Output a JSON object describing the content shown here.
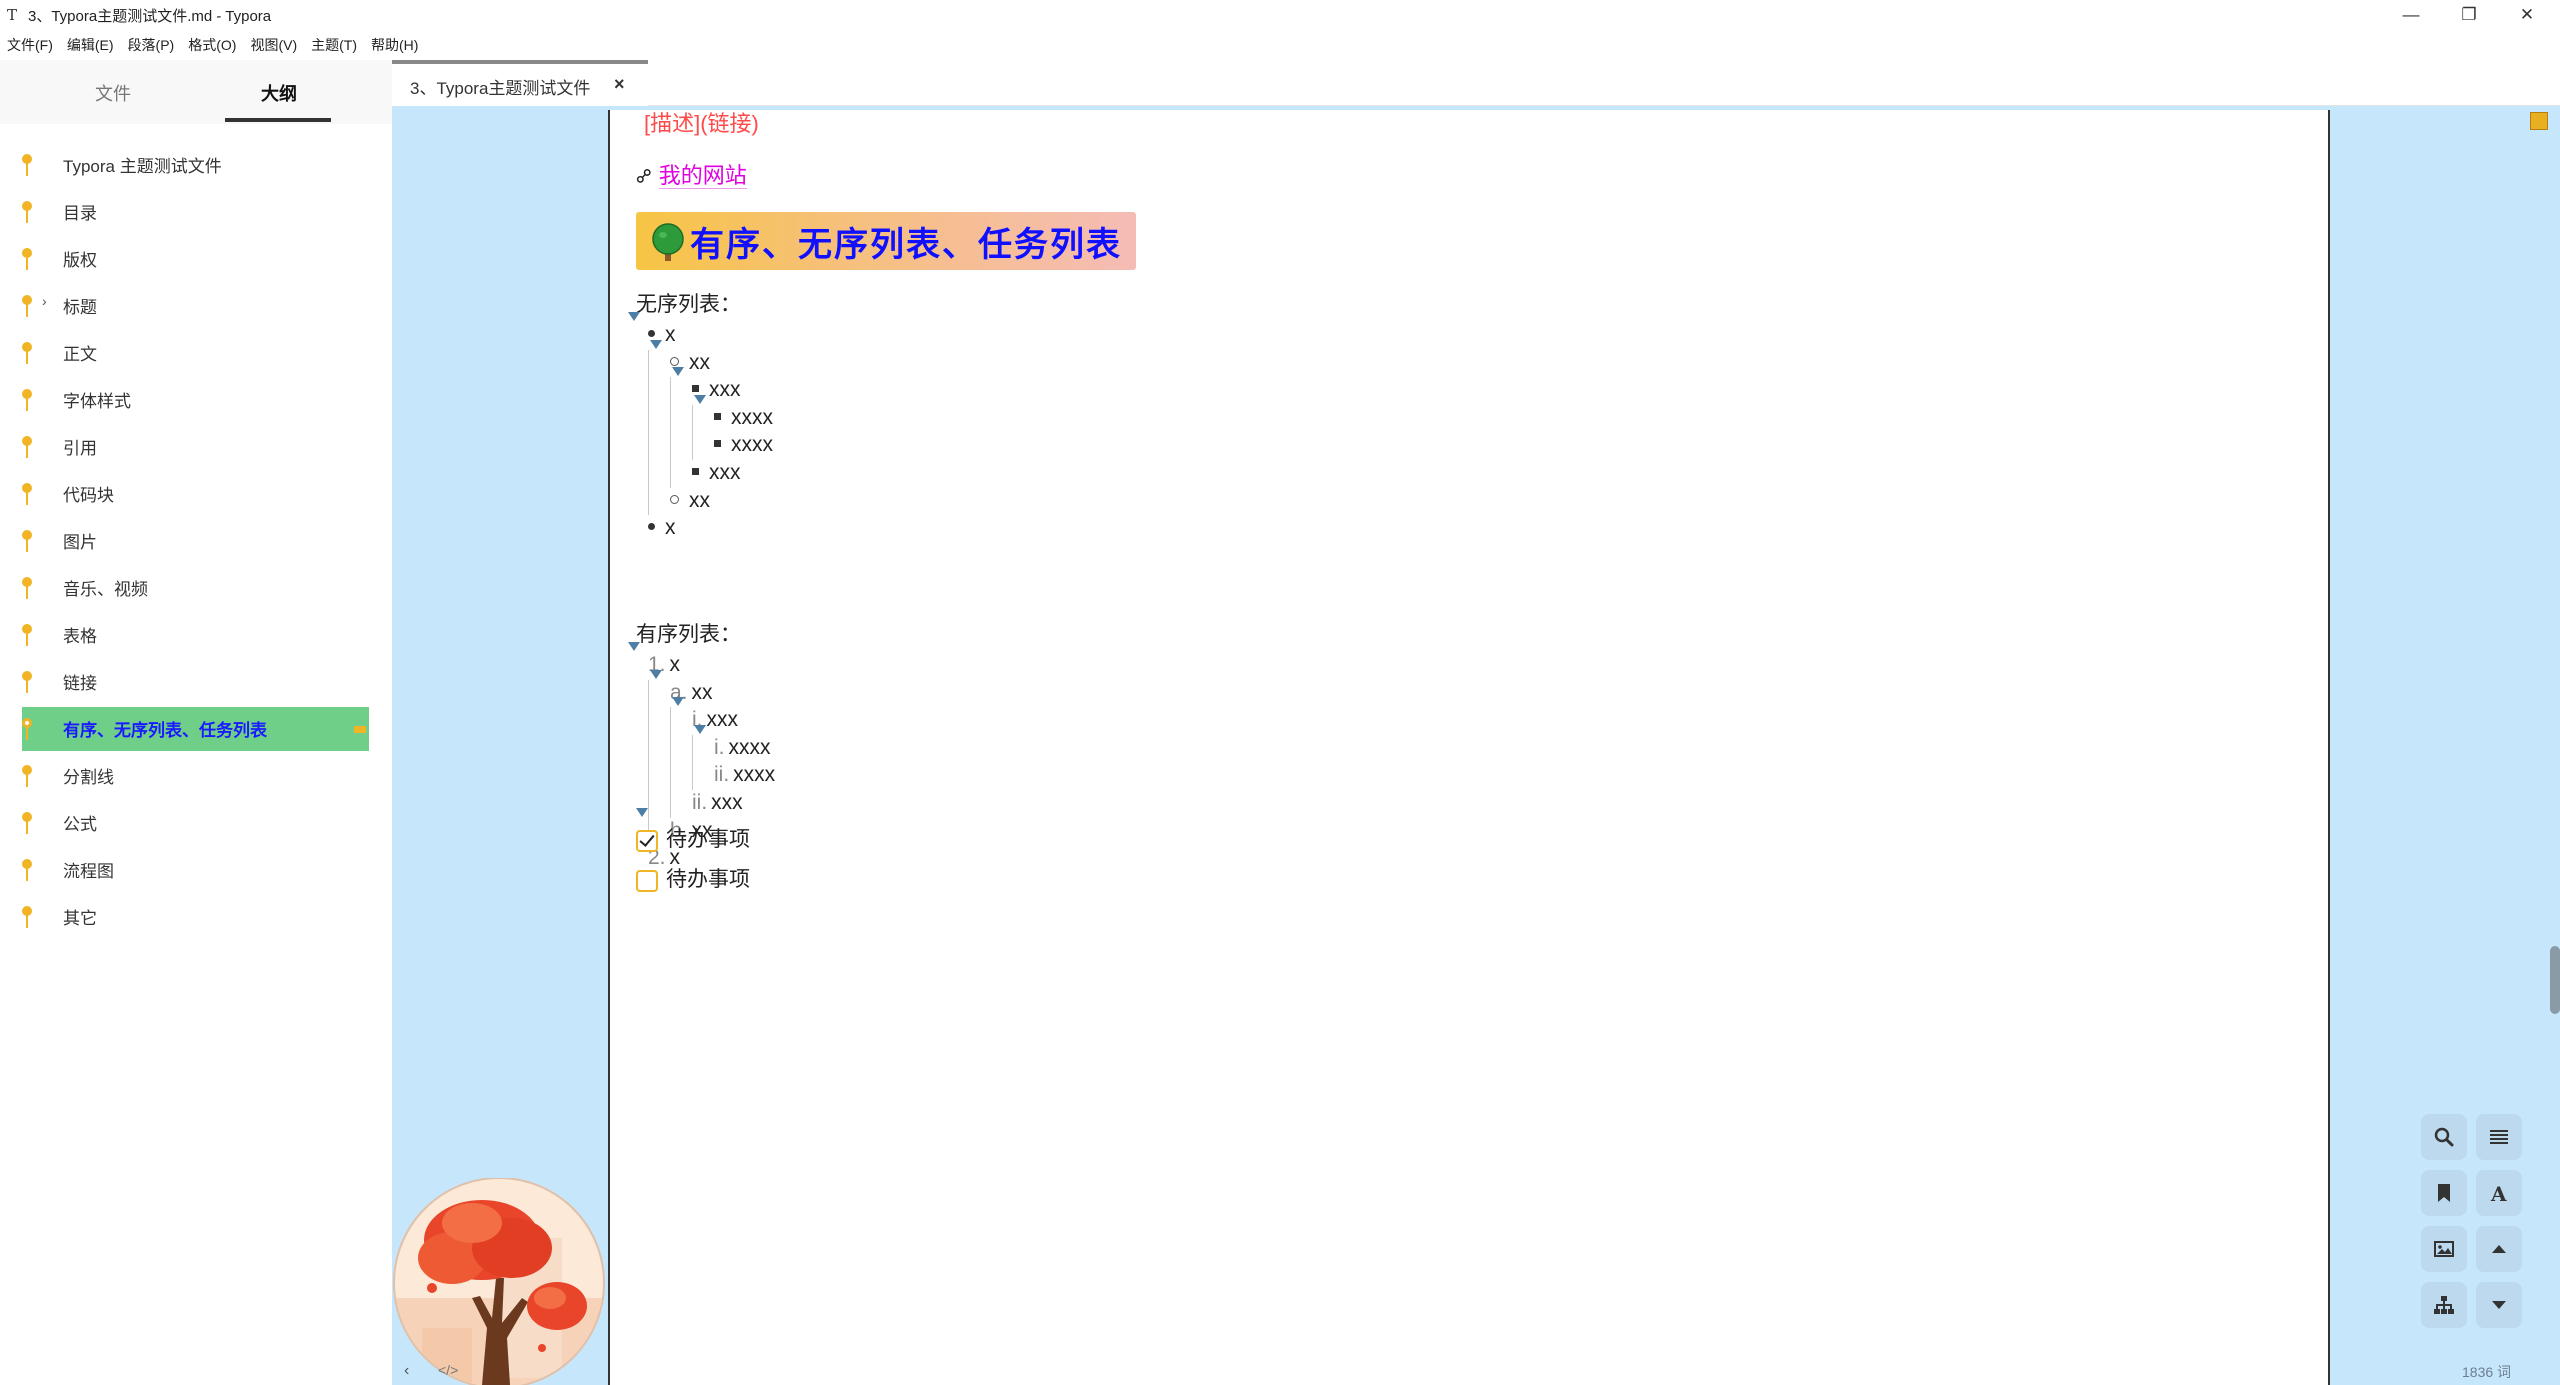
{
  "window": {
    "app_icon": "T",
    "title": "3、Typora主题测试文件.md - Typora",
    "min": "—",
    "max": "❐",
    "close": "✕"
  },
  "menu": [
    "文件(F)",
    "编辑(E)",
    "段落(P)",
    "格式(O)",
    "视图(V)",
    "主题(T)",
    "帮助(H)"
  ],
  "sidebar": {
    "tab_files": "文件",
    "tab_outline": "大纲",
    "outline": [
      {
        "label": "Typora 主题测试文件"
      },
      {
        "label": "目录"
      },
      {
        "label": "版权"
      },
      {
        "label": "标题",
        "caret": "›"
      },
      {
        "label": "正文"
      },
      {
        "label": "字体样式"
      },
      {
        "label": "引用"
      },
      {
        "label": "代码块"
      },
      {
        "label": "图片"
      },
      {
        "label": "音乐、视频"
      },
      {
        "label": "表格"
      },
      {
        "label": "链接"
      },
      {
        "label": "有序、无序列表、任务列表",
        "active": true
      },
      {
        "label": "分割线"
      },
      {
        "label": "公式"
      },
      {
        "label": "流程图"
      },
      {
        "label": "其它"
      }
    ]
  },
  "tab": {
    "label": "3、Typora主题测试文件",
    "close": "×"
  },
  "doc": {
    "fragment": "[描述](链接)",
    "link_text": "我的网站",
    "link_icon": "link-icon",
    "heading": "有序、无序列表、任务列表",
    "unordered_label": "无序列表：",
    "ordered_label": "有序列表：",
    "unordered": [
      {
        "text": "x",
        "level": 0,
        "bullet": "disc",
        "toggle": true
      },
      {
        "text": "xx",
        "level": 1,
        "bullet": "circ",
        "toggle": true
      },
      {
        "text": "xxx",
        "level": 2,
        "bullet": "sq",
        "toggle": true
      },
      {
        "text": "xxxx",
        "level": 3,
        "bullet": "sq",
        "toggle": true
      },
      {
        "text": "xxxx",
        "level": 3,
        "bullet": "sq",
        "toggle": false
      },
      {
        "text": "xxx",
        "level": 2,
        "bullet": "sq",
        "toggle": false
      },
      {
        "text": "xx",
        "level": 1,
        "bullet": "circ",
        "toggle": false
      },
      {
        "text": "x",
        "level": 0,
        "bullet": "disc",
        "toggle": false
      }
    ],
    "ordered": [
      {
        "num": "1.",
        "text": "x",
        "level": 0,
        "toggle": true
      },
      {
        "num": "a.",
        "text": "xx",
        "level": 1,
        "toggle": true
      },
      {
        "num": "i.",
        "text": "xxx",
        "level": 2,
        "toggle": true
      },
      {
        "num": "i.",
        "text": "xxxx",
        "level": 3,
        "toggle": true
      },
      {
        "num": "ii.",
        "text": "xxxx",
        "level": 3,
        "toggle": false
      },
      {
        "num": "ii.",
        "text": "xxx",
        "level": 2,
        "toggle": false
      },
      {
        "num": "b.",
        "text": "xx",
        "level": 1,
        "toggle": false
      },
      {
        "num": "2.",
        "text": "x",
        "level": 0,
        "toggle": false
      }
    ],
    "tasks": [
      {
        "text": "待办事项",
        "checked": true
      },
      {
        "text": "待办事项",
        "checked": false
      }
    ]
  },
  "floating_buttons": [
    "search-icon",
    "outline-list-icon",
    "bookmark-icon",
    "font-icon",
    "image-icon",
    "scroll-up-icon",
    "sitemap-icon",
    "scroll-down-icon"
  ],
  "status": {
    "word_count": "1836 词",
    "sidebar_toggle": "‹",
    "source_toggle": "</>"
  },
  "colors": {
    "editor_bg": "#c6e6fb",
    "accent": "#f0b424",
    "active_outline": "#6fcf88",
    "heading_text": "#1010ff",
    "link_text": "#e000e0"
  }
}
